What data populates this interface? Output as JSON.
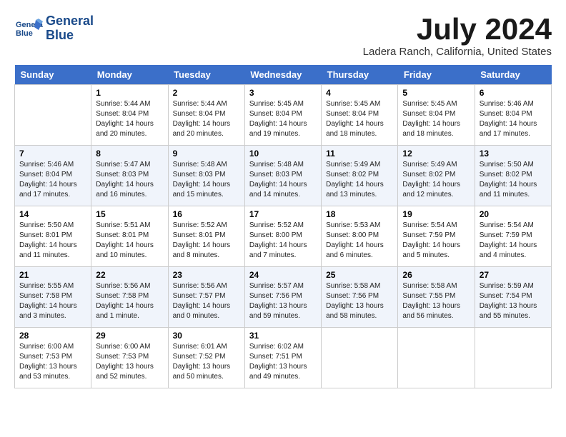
{
  "header": {
    "logo_line1": "General",
    "logo_line2": "Blue",
    "month": "July 2024",
    "location": "Ladera Ranch, California, United States"
  },
  "weekdays": [
    "Sunday",
    "Monday",
    "Tuesday",
    "Wednesday",
    "Thursday",
    "Friday",
    "Saturday"
  ],
  "weeks": [
    [
      {
        "day": "",
        "info": ""
      },
      {
        "day": "1",
        "info": "Sunrise: 5:44 AM\nSunset: 8:04 PM\nDaylight: 14 hours\nand 20 minutes."
      },
      {
        "day": "2",
        "info": "Sunrise: 5:44 AM\nSunset: 8:04 PM\nDaylight: 14 hours\nand 20 minutes."
      },
      {
        "day": "3",
        "info": "Sunrise: 5:45 AM\nSunset: 8:04 PM\nDaylight: 14 hours\nand 19 minutes."
      },
      {
        "day": "4",
        "info": "Sunrise: 5:45 AM\nSunset: 8:04 PM\nDaylight: 14 hours\nand 18 minutes."
      },
      {
        "day": "5",
        "info": "Sunrise: 5:45 AM\nSunset: 8:04 PM\nDaylight: 14 hours\nand 18 minutes."
      },
      {
        "day": "6",
        "info": "Sunrise: 5:46 AM\nSunset: 8:04 PM\nDaylight: 14 hours\nand 17 minutes."
      }
    ],
    [
      {
        "day": "7",
        "info": "Sunrise: 5:46 AM\nSunset: 8:04 PM\nDaylight: 14 hours\nand 17 minutes."
      },
      {
        "day": "8",
        "info": "Sunrise: 5:47 AM\nSunset: 8:03 PM\nDaylight: 14 hours\nand 16 minutes."
      },
      {
        "day": "9",
        "info": "Sunrise: 5:48 AM\nSunset: 8:03 PM\nDaylight: 14 hours\nand 15 minutes."
      },
      {
        "day": "10",
        "info": "Sunrise: 5:48 AM\nSunset: 8:03 PM\nDaylight: 14 hours\nand 14 minutes."
      },
      {
        "day": "11",
        "info": "Sunrise: 5:49 AM\nSunset: 8:02 PM\nDaylight: 14 hours\nand 13 minutes."
      },
      {
        "day": "12",
        "info": "Sunrise: 5:49 AM\nSunset: 8:02 PM\nDaylight: 14 hours\nand 12 minutes."
      },
      {
        "day": "13",
        "info": "Sunrise: 5:50 AM\nSunset: 8:02 PM\nDaylight: 14 hours\nand 11 minutes."
      }
    ],
    [
      {
        "day": "14",
        "info": "Sunrise: 5:50 AM\nSunset: 8:01 PM\nDaylight: 14 hours\nand 11 minutes."
      },
      {
        "day": "15",
        "info": "Sunrise: 5:51 AM\nSunset: 8:01 PM\nDaylight: 14 hours\nand 10 minutes."
      },
      {
        "day": "16",
        "info": "Sunrise: 5:52 AM\nSunset: 8:01 PM\nDaylight: 14 hours\nand 8 minutes."
      },
      {
        "day": "17",
        "info": "Sunrise: 5:52 AM\nSunset: 8:00 PM\nDaylight: 14 hours\nand 7 minutes."
      },
      {
        "day": "18",
        "info": "Sunrise: 5:53 AM\nSunset: 8:00 PM\nDaylight: 14 hours\nand 6 minutes."
      },
      {
        "day": "19",
        "info": "Sunrise: 5:54 AM\nSunset: 7:59 PM\nDaylight: 14 hours\nand 5 minutes."
      },
      {
        "day": "20",
        "info": "Sunrise: 5:54 AM\nSunset: 7:59 PM\nDaylight: 14 hours\nand 4 minutes."
      }
    ],
    [
      {
        "day": "21",
        "info": "Sunrise: 5:55 AM\nSunset: 7:58 PM\nDaylight: 14 hours\nand 3 minutes."
      },
      {
        "day": "22",
        "info": "Sunrise: 5:56 AM\nSunset: 7:58 PM\nDaylight: 14 hours\nand 1 minute."
      },
      {
        "day": "23",
        "info": "Sunrise: 5:56 AM\nSunset: 7:57 PM\nDaylight: 14 hours\nand 0 minutes."
      },
      {
        "day": "24",
        "info": "Sunrise: 5:57 AM\nSunset: 7:56 PM\nDaylight: 13 hours\nand 59 minutes."
      },
      {
        "day": "25",
        "info": "Sunrise: 5:58 AM\nSunset: 7:56 PM\nDaylight: 13 hours\nand 58 minutes."
      },
      {
        "day": "26",
        "info": "Sunrise: 5:58 AM\nSunset: 7:55 PM\nDaylight: 13 hours\nand 56 minutes."
      },
      {
        "day": "27",
        "info": "Sunrise: 5:59 AM\nSunset: 7:54 PM\nDaylight: 13 hours\nand 55 minutes."
      }
    ],
    [
      {
        "day": "28",
        "info": "Sunrise: 6:00 AM\nSunset: 7:53 PM\nDaylight: 13 hours\nand 53 minutes."
      },
      {
        "day": "29",
        "info": "Sunrise: 6:00 AM\nSunset: 7:53 PM\nDaylight: 13 hours\nand 52 minutes."
      },
      {
        "day": "30",
        "info": "Sunrise: 6:01 AM\nSunset: 7:52 PM\nDaylight: 13 hours\nand 50 minutes."
      },
      {
        "day": "31",
        "info": "Sunrise: 6:02 AM\nSunset: 7:51 PM\nDaylight: 13 hours\nand 49 minutes."
      },
      {
        "day": "",
        "info": ""
      },
      {
        "day": "",
        "info": ""
      },
      {
        "day": "",
        "info": ""
      }
    ]
  ]
}
